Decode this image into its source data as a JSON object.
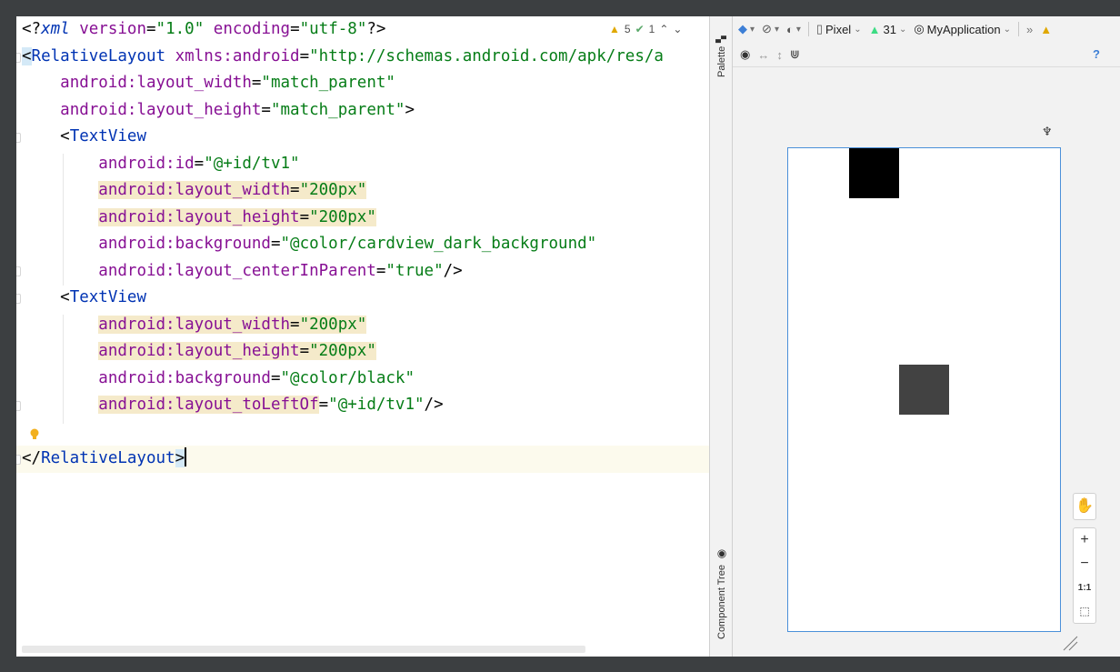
{
  "editor": {
    "status": {
      "warnings": "5",
      "weak_warnings": "1"
    },
    "lines": [
      [
        [
          "t-punc",
          "<?"
        ],
        [
          "t-decl",
          "xml"
        ],
        [
          "t-punc",
          " "
        ],
        [
          "t-attr",
          "version"
        ],
        [
          "t-punc",
          "="
        ],
        [
          "t-val",
          "\"1.0\""
        ],
        [
          "t-punc",
          " "
        ],
        [
          "t-attr",
          "encoding"
        ],
        [
          "t-punc",
          "="
        ],
        [
          "t-val",
          "\"utf-8\""
        ],
        [
          "t-punc",
          "?>"
        ]
      ],
      [
        [
          "t-punc hl-tag",
          "<"
        ],
        [
          "t-tag",
          "RelativeLayout"
        ],
        [
          "t-punc",
          " "
        ],
        [
          "t-ns",
          "xmlns:android"
        ],
        [
          "t-punc",
          "="
        ],
        [
          "t-val",
          "\"http://schemas.android.com/apk/res/a"
        ]
      ],
      [
        [
          "t-punc",
          "    "
        ],
        [
          "t-ns",
          "android:layout_width"
        ],
        [
          "t-punc",
          "="
        ],
        [
          "t-val",
          "\"match_parent\""
        ]
      ],
      [
        [
          "t-punc",
          "    "
        ],
        [
          "t-ns",
          "android:layout_height"
        ],
        [
          "t-punc",
          "="
        ],
        [
          "t-val",
          "\"match_parent\""
        ],
        [
          "t-punc",
          ">"
        ]
      ],
      [
        [
          "t-punc",
          "    <"
        ],
        [
          "t-tag",
          "TextView"
        ]
      ],
      [
        [
          "t-punc",
          "        "
        ],
        [
          "t-ns",
          "android:id"
        ],
        [
          "t-punc",
          "="
        ],
        [
          "t-val",
          "\"@+id/tv1\""
        ]
      ],
      [
        [
          "t-punc",
          "        "
        ],
        [
          "t-ns hl",
          "android:layout_width"
        ],
        [
          "t-punc hl",
          "="
        ],
        [
          "t-val hl",
          "\"200px\""
        ]
      ],
      [
        [
          "t-punc",
          "        "
        ],
        [
          "t-ns hl",
          "android:layout_height"
        ],
        [
          "t-punc hl",
          "="
        ],
        [
          "t-val hl",
          "\"200px\""
        ]
      ],
      [
        [
          "t-punc",
          "        "
        ],
        [
          "t-ns",
          "android:background"
        ],
        [
          "t-punc",
          "="
        ],
        [
          "t-val",
          "\"@color/cardview_dark_background\""
        ]
      ],
      [
        [
          "t-punc",
          "        "
        ],
        [
          "t-ns",
          "android:layout_centerInParent"
        ],
        [
          "t-punc",
          "="
        ],
        [
          "t-val",
          "\"true\""
        ],
        [
          "t-punc",
          "/>"
        ]
      ],
      [
        [
          "t-punc",
          "    <"
        ],
        [
          "t-tag",
          "TextView"
        ]
      ],
      [
        [
          "t-punc",
          "        "
        ],
        [
          "t-ns hl",
          "android:layout_width"
        ],
        [
          "t-punc hl",
          "="
        ],
        [
          "t-val hl",
          "\"200px\""
        ]
      ],
      [
        [
          "t-punc",
          "        "
        ],
        [
          "t-ns hl",
          "android:layout_height"
        ],
        [
          "t-punc hl",
          "="
        ],
        [
          "t-val hl",
          "\"200px\""
        ]
      ],
      [
        [
          "t-punc",
          "        "
        ],
        [
          "t-ns",
          "android:background"
        ],
        [
          "t-punc",
          "="
        ],
        [
          "t-val",
          "\"@color/black\""
        ]
      ],
      [
        [
          "t-punc",
          "        "
        ],
        [
          "t-ns hl",
          "android:layout_toLeftOf"
        ],
        [
          "t-punc",
          "="
        ],
        [
          "t-val",
          "\"@+id/tv1\""
        ],
        [
          "t-punc",
          "/>"
        ]
      ],
      [],
      [
        [
          "t-punc",
          "</"
        ],
        [
          "t-tag",
          "RelativeLayout"
        ],
        [
          "t-punc hl-tag",
          ">"
        ]
      ]
    ]
  },
  "sidebar": {
    "palette_label": "Palette",
    "component_tree_label": "Component Tree"
  },
  "design": {
    "device_label": "Pixel",
    "api_label": "31",
    "app_label": "MyApplication",
    "zoom_reset_label": "1:1",
    "colors": {
      "black_view": "#000000",
      "dark_view": "#424242",
      "accent": "#4a90d9"
    }
  }
}
